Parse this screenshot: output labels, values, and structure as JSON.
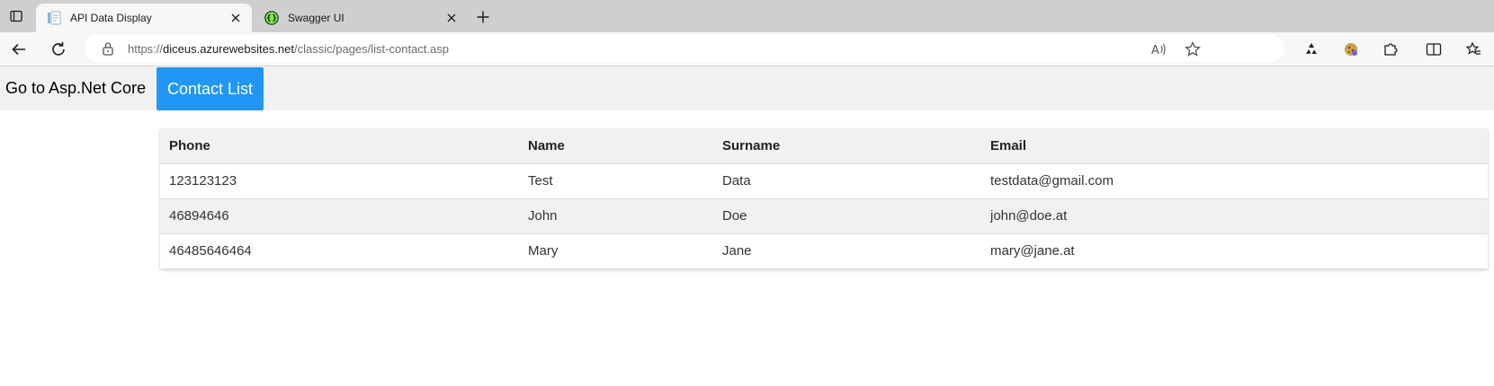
{
  "browser": {
    "tabs": [
      {
        "title": "API Data Display",
        "active": true,
        "favicon": "document-icon"
      },
      {
        "title": "Swagger UI",
        "active": false,
        "favicon": "swagger-icon"
      }
    ],
    "address": {
      "url_scheme": "https://",
      "url_host": "diceus.azurewebsites.net",
      "url_path": "/classic/pages/list-contact.asp"
    },
    "colors": {
      "tab_strip": "#cfcfcf",
      "toolbar": "#f7f7f7"
    }
  },
  "nav": {
    "asp_link": "Go to Asp.Net Core",
    "contacts_link": "Contact List",
    "accent": "#2196f3"
  },
  "table": {
    "headers": {
      "phone": "Phone",
      "name": "Name",
      "surname": "Surname",
      "email": "Email"
    },
    "rows": [
      {
        "phone": "123123123",
        "name": "Test",
        "surname": "Data",
        "email": "testdata@gmail.com"
      },
      {
        "phone": "46894646",
        "name": "John",
        "surname": "Doe",
        "email": "john@doe.at"
      },
      {
        "phone": "46485646464",
        "name": "Mary",
        "surname": "Jane",
        "email": "mary@jane.at"
      }
    ]
  }
}
